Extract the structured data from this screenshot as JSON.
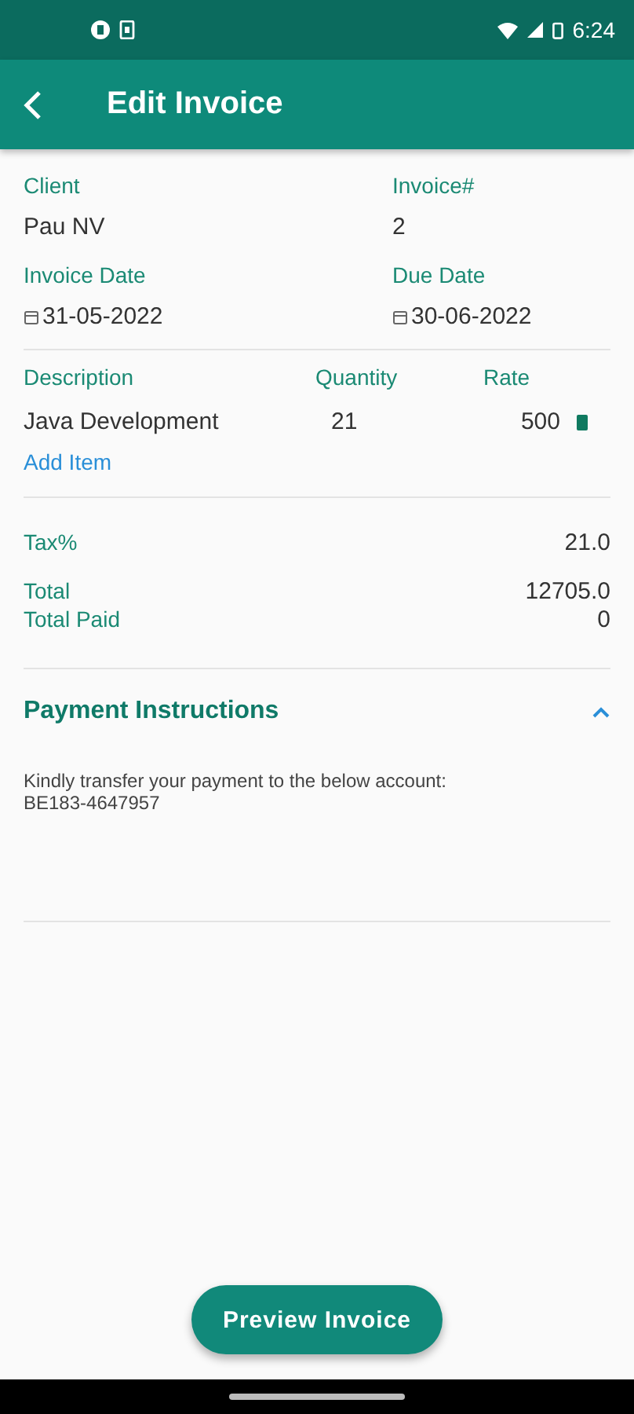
{
  "status_bar": {
    "time": "6:24"
  },
  "app_bar": {
    "title": "Edit Invoice"
  },
  "header": {
    "fields": [
      {
        "label": "Client",
        "value": "Pau NV",
        "kind": "text"
      },
      {
        "label": "Invoice#",
        "value": "2",
        "kind": "text"
      },
      {
        "label": "Invoice Date",
        "value": "31-05-2022",
        "kind": "date"
      },
      {
        "label": "Due Date",
        "value": "30-06-2022",
        "kind": "date"
      }
    ]
  },
  "items": {
    "columns": [
      "Description",
      "Quantity",
      "Rate"
    ],
    "rows": [
      {
        "description": "Java Development",
        "quantity": "21",
        "rate": "500"
      }
    ],
    "add_label": "Add Item"
  },
  "summary": {
    "tax_label": "Tax%",
    "tax": "21.0",
    "total_label": "Total",
    "total": "12705.0",
    "paid_label": "Total Paid",
    "paid": "0"
  },
  "payment": {
    "title": "Payment Instructions",
    "expanded": true,
    "text": "Kindly transfer your payment to the below account:\nBE183-4647957"
  },
  "preview_button": "Preview Invoice"
}
